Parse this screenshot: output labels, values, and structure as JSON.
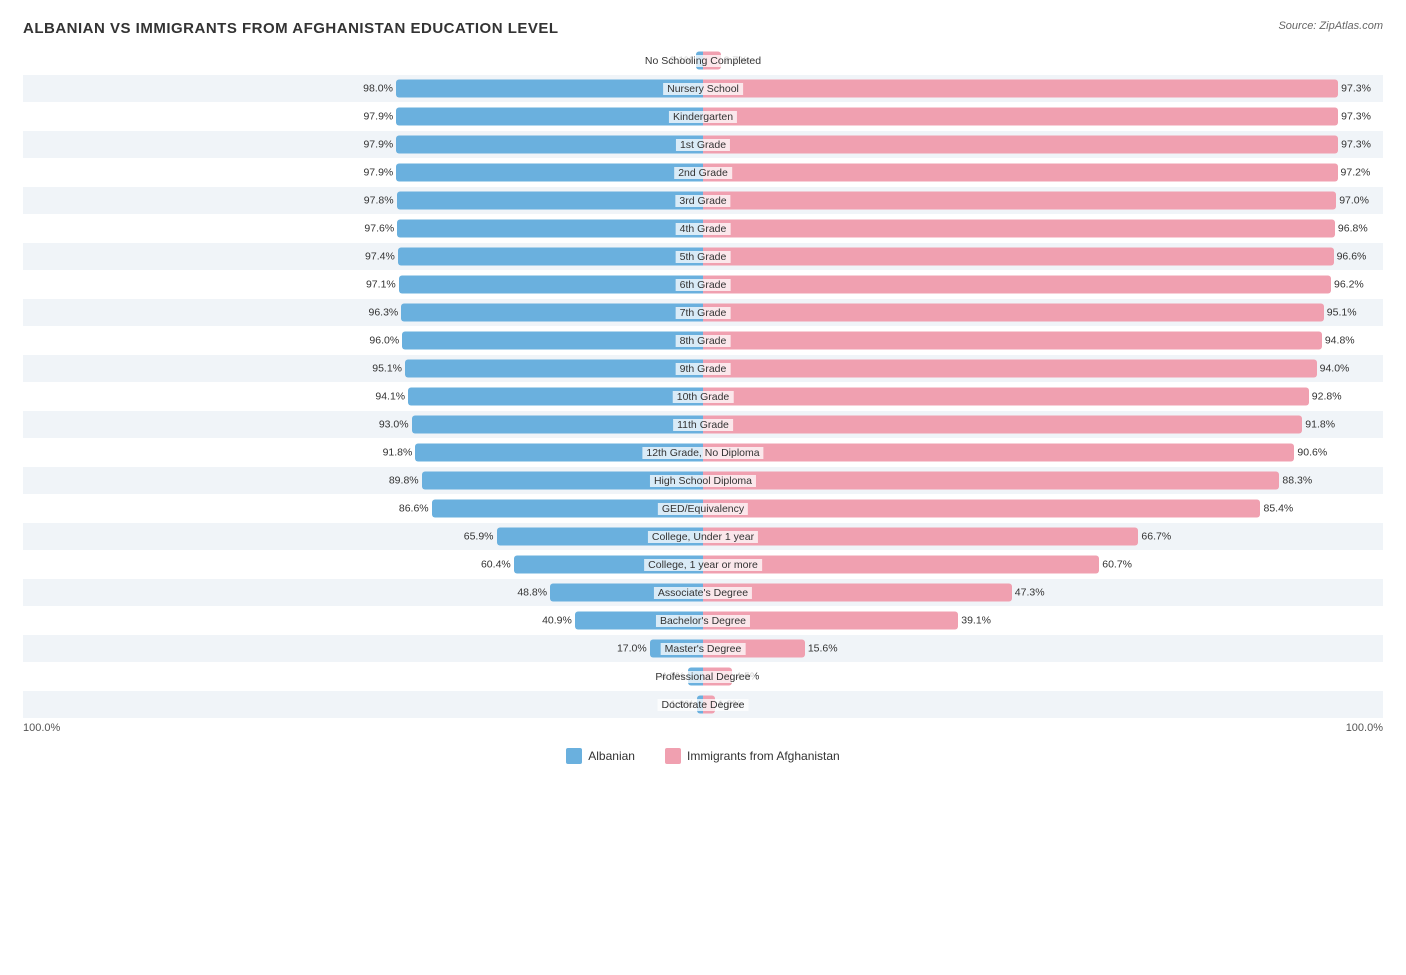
{
  "title": "ALBANIAN VS IMMIGRANTS FROM AFGHANISTAN EDUCATION LEVEL",
  "source": "Source: ZipAtlas.com",
  "colors": {
    "left": "#6ab0de",
    "right": "#f0a0b0"
  },
  "legend": {
    "left_label": "Albanian",
    "right_label": "Immigrants from Afghanistan"
  },
  "bottom_label_left": "100.0%",
  "bottom_label_right": "100.0%",
  "rows": [
    {
      "label": "No Schooling Completed",
      "left_val": "2.1%",
      "left_pct": 2.1,
      "right_val": "2.7%",
      "right_pct": 2.7,
      "shaded": false
    },
    {
      "label": "Nursery School",
      "left_val": "98.0%",
      "left_pct": 98.0,
      "right_val": "97.3%",
      "right_pct": 97.3,
      "shaded": true
    },
    {
      "label": "Kindergarten",
      "left_val": "97.9%",
      "left_pct": 97.9,
      "right_val": "97.3%",
      "right_pct": 97.3,
      "shaded": false
    },
    {
      "label": "1st Grade",
      "left_val": "97.9%",
      "left_pct": 97.9,
      "right_val": "97.3%",
      "right_pct": 97.3,
      "shaded": true
    },
    {
      "label": "2nd Grade",
      "left_val": "97.9%",
      "left_pct": 97.9,
      "right_val": "97.2%",
      "right_pct": 97.2,
      "shaded": false
    },
    {
      "label": "3rd Grade",
      "left_val": "97.8%",
      "left_pct": 97.8,
      "right_val": "97.0%",
      "right_pct": 97.0,
      "shaded": true
    },
    {
      "label": "4th Grade",
      "left_val": "97.6%",
      "left_pct": 97.6,
      "right_val": "96.8%",
      "right_pct": 96.8,
      "shaded": false
    },
    {
      "label": "5th Grade",
      "left_val": "97.4%",
      "left_pct": 97.4,
      "right_val": "96.6%",
      "right_pct": 96.6,
      "shaded": true
    },
    {
      "label": "6th Grade",
      "left_val": "97.1%",
      "left_pct": 97.1,
      "right_val": "96.2%",
      "right_pct": 96.2,
      "shaded": false
    },
    {
      "label": "7th Grade",
      "left_val": "96.3%",
      "left_pct": 96.3,
      "right_val": "95.1%",
      "right_pct": 95.1,
      "shaded": true
    },
    {
      "label": "8th Grade",
      "left_val": "96.0%",
      "left_pct": 96.0,
      "right_val": "94.8%",
      "right_pct": 94.8,
      "shaded": false
    },
    {
      "label": "9th Grade",
      "left_val": "95.1%",
      "left_pct": 95.1,
      "right_val": "94.0%",
      "right_pct": 94.0,
      "shaded": true
    },
    {
      "label": "10th Grade",
      "left_val": "94.1%",
      "left_pct": 94.1,
      "right_val": "92.8%",
      "right_pct": 92.8,
      "shaded": false
    },
    {
      "label": "11th Grade",
      "left_val": "93.0%",
      "left_pct": 93.0,
      "right_val": "91.8%",
      "right_pct": 91.8,
      "shaded": true
    },
    {
      "label": "12th Grade, No Diploma",
      "left_val": "91.8%",
      "left_pct": 91.8,
      "right_val": "90.6%",
      "right_pct": 90.6,
      "shaded": false
    },
    {
      "label": "High School Diploma",
      "left_val": "89.8%",
      "left_pct": 89.8,
      "right_val": "88.3%",
      "right_pct": 88.3,
      "shaded": true
    },
    {
      "label": "GED/Equivalency",
      "left_val": "86.6%",
      "left_pct": 86.6,
      "right_val": "85.4%",
      "right_pct": 85.4,
      "shaded": false
    },
    {
      "label": "College, Under 1 year",
      "left_val": "65.9%",
      "left_pct": 65.9,
      "right_val": "66.7%",
      "right_pct": 66.7,
      "shaded": true
    },
    {
      "label": "College, 1 year or more",
      "left_val": "60.4%",
      "left_pct": 60.4,
      "right_val": "60.7%",
      "right_pct": 60.7,
      "shaded": false
    },
    {
      "label": "Associate's Degree",
      "left_val": "48.8%",
      "left_pct": 48.8,
      "right_val": "47.3%",
      "right_pct": 47.3,
      "shaded": true
    },
    {
      "label": "Bachelor's Degree",
      "left_val": "40.9%",
      "left_pct": 40.9,
      "right_val": "39.1%",
      "right_pct": 39.1,
      "shaded": false
    },
    {
      "label": "Master's Degree",
      "left_val": "17.0%",
      "left_pct": 17.0,
      "right_val": "15.6%",
      "right_pct": 15.6,
      "shaded": true
    },
    {
      "label": "Professional Degree",
      "left_val": "4.9%",
      "left_pct": 4.9,
      "right_val": "4.5%",
      "right_pct": 4.5,
      "shaded": false
    },
    {
      "label": "Doctorate Degree",
      "left_val": "1.9%",
      "left_pct": 1.9,
      "right_val": "1.8%",
      "right_pct": 1.8,
      "shaded": true
    }
  ]
}
